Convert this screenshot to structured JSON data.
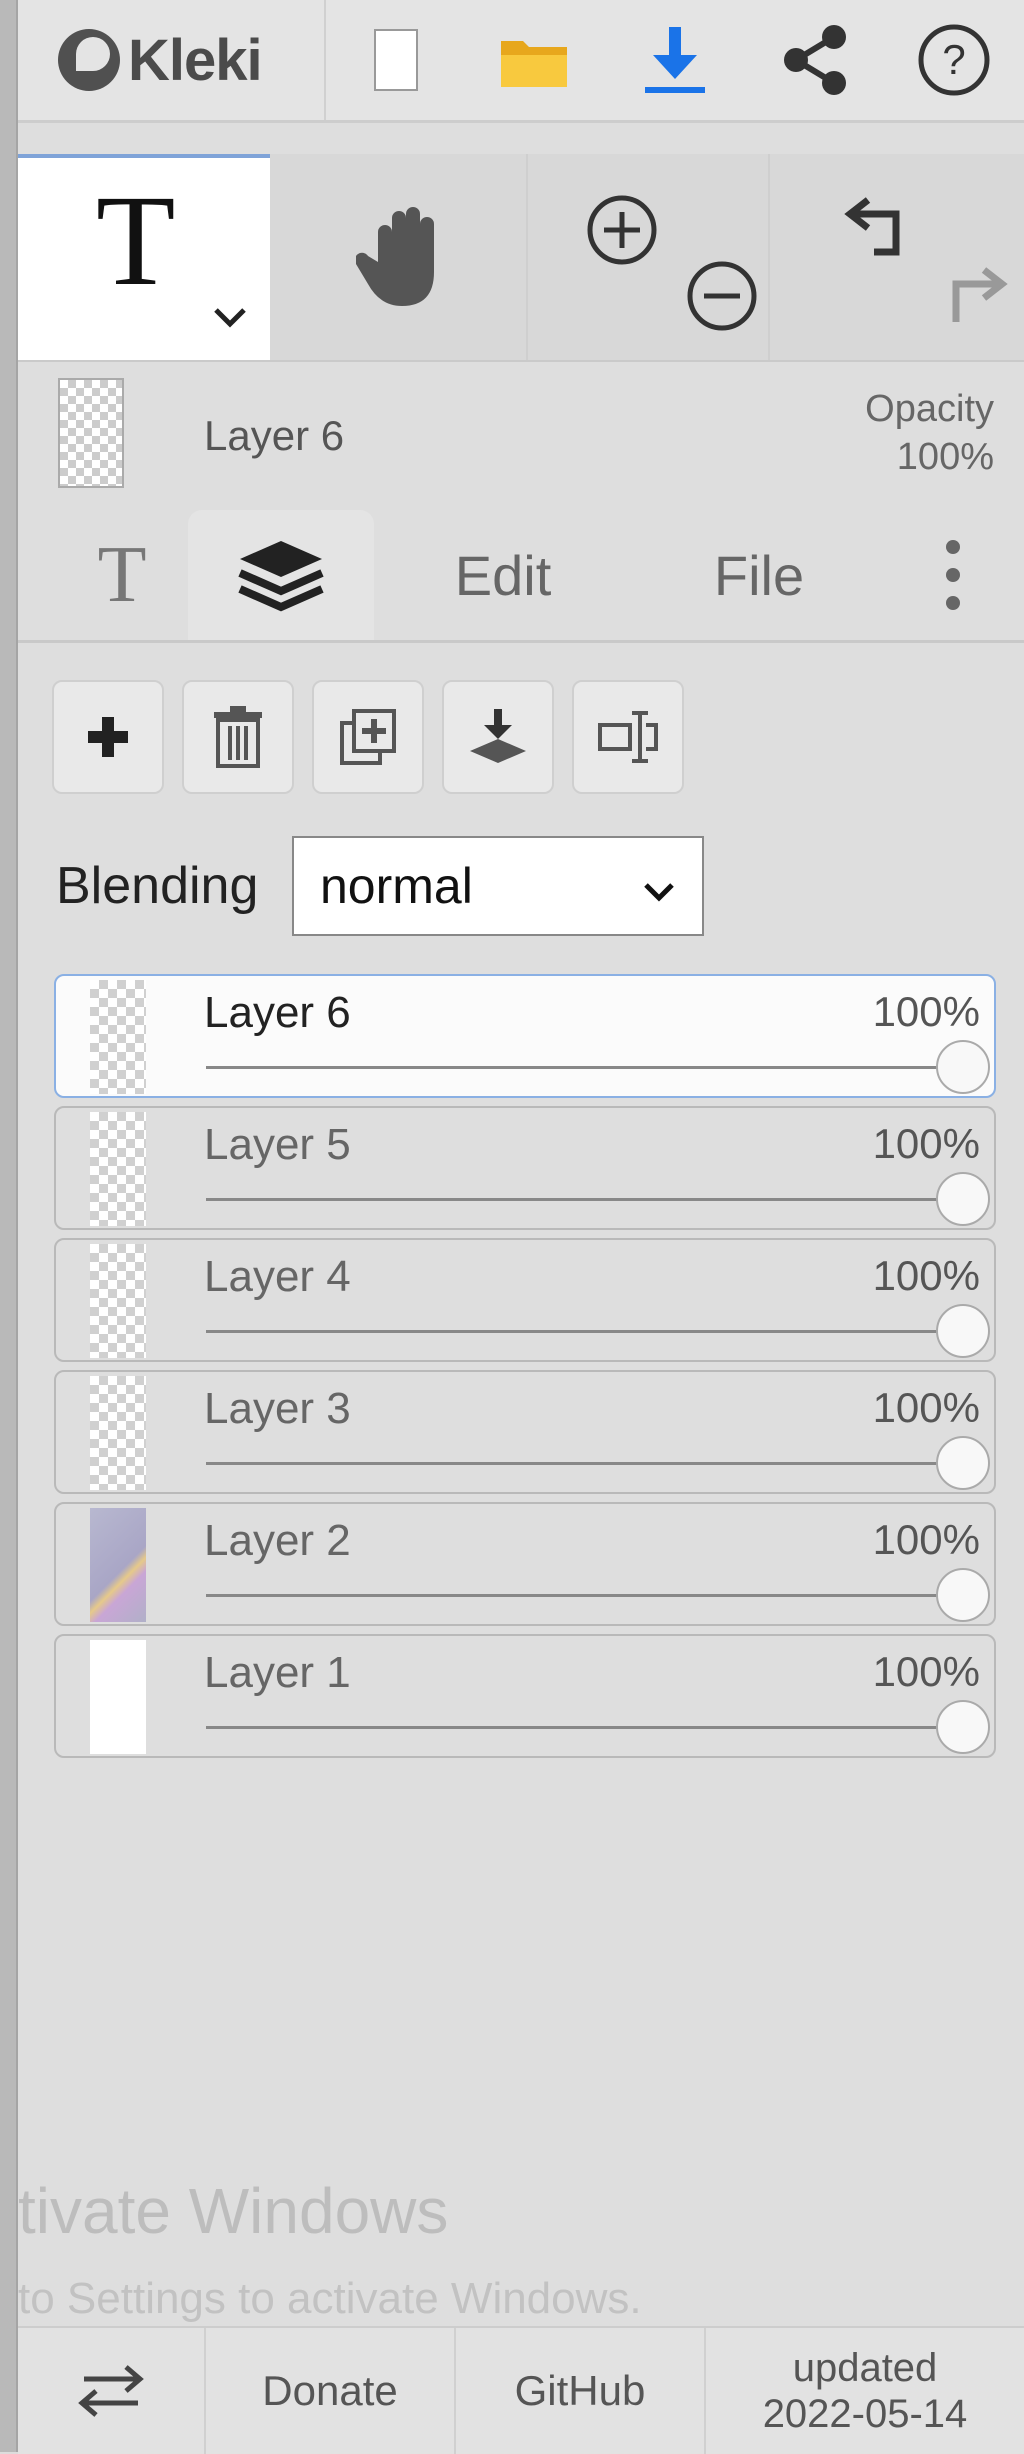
{
  "app": {
    "name": "Kleki"
  },
  "header": {
    "icons": [
      "new-image-icon",
      "open-folder-icon",
      "download-icon",
      "share-icon",
      "help-icon"
    ],
    "accent_color": "#1a73e8",
    "folder_color": "#f2b632"
  },
  "tools": {
    "active_tool_char": "T",
    "items": [
      "text-tool",
      "hand-tool",
      "zoom-in",
      "zoom-out",
      "undo",
      "redo"
    ]
  },
  "layer_info": {
    "name": "Layer 6",
    "opacity_label": "Opacity",
    "opacity_value": "100%"
  },
  "tabs": [
    {
      "label": "T",
      "icon": "text-tab-icon"
    },
    {
      "label": "",
      "icon": "layers-icon",
      "active": true
    },
    {
      "label": "Edit"
    },
    {
      "label": "File"
    },
    {
      "label": "",
      "icon": "more-vertical-icon"
    }
  ],
  "layer_actions": [
    "add-layer-icon",
    "delete-layer-icon",
    "duplicate-layer-icon",
    "merge-down-icon",
    "rename-layer-icon"
  ],
  "blending": {
    "label": "Blending",
    "value": "normal"
  },
  "layers": [
    {
      "name": "Layer 6",
      "opacity": "100%",
      "active": true
    },
    {
      "name": "Layer 5",
      "opacity": "100%"
    },
    {
      "name": "Layer 4",
      "opacity": "100%"
    },
    {
      "name": "Layer 3",
      "opacity": "100%"
    },
    {
      "name": "Layer 2",
      "opacity": "100%"
    },
    {
      "name": "Layer 1",
      "opacity": "100%"
    }
  ],
  "watermark": {
    "line1": "tivate Windows",
    "line2": "to Settings to activate Windows."
  },
  "footer": {
    "donate": "Donate",
    "github": "GitHub",
    "updated_label": "updated",
    "updated_date": "2022-05-14"
  }
}
